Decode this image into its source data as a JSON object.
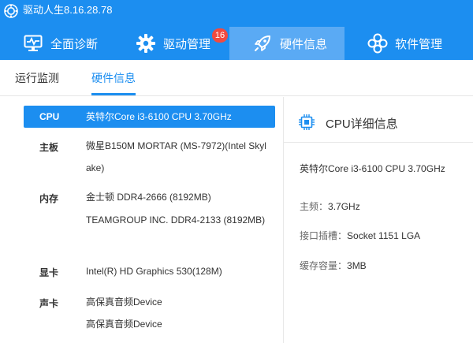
{
  "app": {
    "title": "驱动人生8.16.28.78"
  },
  "nav": {
    "tabs": [
      {
        "label": "全面诊断",
        "icon": "monitor-pulse-icon"
      },
      {
        "label": "驱动管理",
        "icon": "gear-icon",
        "badge": "16"
      },
      {
        "label": "硬件信息",
        "icon": "rocket-icon",
        "active": true
      },
      {
        "label": "软件管理",
        "icon": "apps-icon"
      }
    ]
  },
  "subtabs": [
    {
      "label": "运行监测"
    },
    {
      "label": "硬件信息",
      "active": true
    }
  ],
  "hardware": {
    "cpu": {
      "label": "CPU",
      "value": "英特尔Core i3-6100 CPU 3.70GHz"
    },
    "motherboard": {
      "label": "主板",
      "value": "微星B150M MORTAR (MS-7972)(Intel Skylake)"
    },
    "memory": {
      "label": "内存",
      "values": [
        "金士顿 DDR4-2666 (8192MB)",
        "TEAMGROUP INC. DDR4-2133 (8192MB)"
      ]
    },
    "gpu": {
      "label": "显卡",
      "value": "Intel(R) HD Graphics 530(128M)"
    },
    "sound": {
      "label": "声卡",
      "values": [
        "高保真音频Device",
        "高保真音频Device"
      ]
    }
  },
  "detail": {
    "title": "CPU详细信息",
    "name": "英特尔Core i3-6100 CPU 3.70GHz",
    "specs": [
      {
        "key": "主频：",
        "value": "3.7GHz"
      },
      {
        "key": "接口插槽：",
        "value": "Socket 1151 LGA"
      },
      {
        "key": "缓存容量：",
        "value": "3MB"
      }
    ]
  },
  "colors": {
    "primary": "#1c8ef0",
    "nav_active": "#5aaaf4",
    "badge": "#f24a3f"
  }
}
